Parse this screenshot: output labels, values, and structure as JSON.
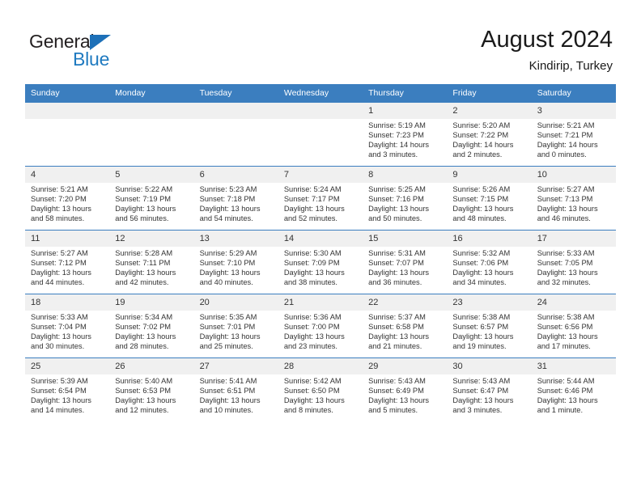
{
  "brand": {
    "name_top": "General",
    "name_bottom": "Blue",
    "triangle_color": "#1d70b8",
    "blue_text_color": "#1f7ac0"
  },
  "header": {
    "title": "August 2024",
    "subtitle": "Kindirip, Turkey",
    "header_bg_color": "#3b7ebf",
    "daynum_bg_color": "#f0f0f0"
  },
  "weekday_headers": [
    "Sunday",
    "Monday",
    "Tuesday",
    "Wednesday",
    "Thursday",
    "Friday",
    "Saturday"
  ],
  "labels": {
    "sunrise": "Sunrise:",
    "sunset": "Sunset:",
    "daylight": "Daylight:"
  },
  "weeks": [
    [
      {
        "day": "",
        "blank": true
      },
      {
        "day": "",
        "blank": true
      },
      {
        "day": "",
        "blank": true
      },
      {
        "day": "",
        "blank": true
      },
      {
        "day": "1",
        "sunrise": "Sunrise: 5:19 AM",
        "sunset": "Sunset: 7:23 PM",
        "daylight_line1": "Daylight: 14 hours",
        "daylight_line2": "and 3 minutes."
      },
      {
        "day": "2",
        "sunrise": "Sunrise: 5:20 AM",
        "sunset": "Sunset: 7:22 PM",
        "daylight_line1": "Daylight: 14 hours",
        "daylight_line2": "and 2 minutes."
      },
      {
        "day": "3",
        "sunrise": "Sunrise: 5:21 AM",
        "sunset": "Sunset: 7:21 PM",
        "daylight_line1": "Daylight: 14 hours",
        "daylight_line2": "and 0 minutes."
      }
    ],
    [
      {
        "day": "4",
        "sunrise": "Sunrise: 5:21 AM",
        "sunset": "Sunset: 7:20 PM",
        "daylight_line1": "Daylight: 13 hours",
        "daylight_line2": "and 58 minutes."
      },
      {
        "day": "5",
        "sunrise": "Sunrise: 5:22 AM",
        "sunset": "Sunset: 7:19 PM",
        "daylight_line1": "Daylight: 13 hours",
        "daylight_line2": "and 56 minutes."
      },
      {
        "day": "6",
        "sunrise": "Sunrise: 5:23 AM",
        "sunset": "Sunset: 7:18 PM",
        "daylight_line1": "Daylight: 13 hours",
        "daylight_line2": "and 54 minutes."
      },
      {
        "day": "7",
        "sunrise": "Sunrise: 5:24 AM",
        "sunset": "Sunset: 7:17 PM",
        "daylight_line1": "Daylight: 13 hours",
        "daylight_line2": "and 52 minutes."
      },
      {
        "day": "8",
        "sunrise": "Sunrise: 5:25 AM",
        "sunset": "Sunset: 7:16 PM",
        "daylight_line1": "Daylight: 13 hours",
        "daylight_line2": "and 50 minutes."
      },
      {
        "day": "9",
        "sunrise": "Sunrise: 5:26 AM",
        "sunset": "Sunset: 7:15 PM",
        "daylight_line1": "Daylight: 13 hours",
        "daylight_line2": "and 48 minutes."
      },
      {
        "day": "10",
        "sunrise": "Sunrise: 5:27 AM",
        "sunset": "Sunset: 7:13 PM",
        "daylight_line1": "Daylight: 13 hours",
        "daylight_line2": "and 46 minutes."
      }
    ],
    [
      {
        "day": "11",
        "sunrise": "Sunrise: 5:27 AM",
        "sunset": "Sunset: 7:12 PM",
        "daylight_line1": "Daylight: 13 hours",
        "daylight_line2": "and 44 minutes."
      },
      {
        "day": "12",
        "sunrise": "Sunrise: 5:28 AM",
        "sunset": "Sunset: 7:11 PM",
        "daylight_line1": "Daylight: 13 hours",
        "daylight_line2": "and 42 minutes."
      },
      {
        "day": "13",
        "sunrise": "Sunrise: 5:29 AM",
        "sunset": "Sunset: 7:10 PM",
        "daylight_line1": "Daylight: 13 hours",
        "daylight_line2": "and 40 minutes."
      },
      {
        "day": "14",
        "sunrise": "Sunrise: 5:30 AM",
        "sunset": "Sunset: 7:09 PM",
        "daylight_line1": "Daylight: 13 hours",
        "daylight_line2": "and 38 minutes."
      },
      {
        "day": "15",
        "sunrise": "Sunrise: 5:31 AM",
        "sunset": "Sunset: 7:07 PM",
        "daylight_line1": "Daylight: 13 hours",
        "daylight_line2": "and 36 minutes."
      },
      {
        "day": "16",
        "sunrise": "Sunrise: 5:32 AM",
        "sunset": "Sunset: 7:06 PM",
        "daylight_line1": "Daylight: 13 hours",
        "daylight_line2": "and 34 minutes."
      },
      {
        "day": "17",
        "sunrise": "Sunrise: 5:33 AM",
        "sunset": "Sunset: 7:05 PM",
        "daylight_line1": "Daylight: 13 hours",
        "daylight_line2": "and 32 minutes."
      }
    ],
    [
      {
        "day": "18",
        "sunrise": "Sunrise: 5:33 AM",
        "sunset": "Sunset: 7:04 PM",
        "daylight_line1": "Daylight: 13 hours",
        "daylight_line2": "and 30 minutes."
      },
      {
        "day": "19",
        "sunrise": "Sunrise: 5:34 AM",
        "sunset": "Sunset: 7:02 PM",
        "daylight_line1": "Daylight: 13 hours",
        "daylight_line2": "and 28 minutes."
      },
      {
        "day": "20",
        "sunrise": "Sunrise: 5:35 AM",
        "sunset": "Sunset: 7:01 PM",
        "daylight_line1": "Daylight: 13 hours",
        "daylight_line2": "and 25 minutes."
      },
      {
        "day": "21",
        "sunrise": "Sunrise: 5:36 AM",
        "sunset": "Sunset: 7:00 PM",
        "daylight_line1": "Daylight: 13 hours",
        "daylight_line2": "and 23 minutes."
      },
      {
        "day": "22",
        "sunrise": "Sunrise: 5:37 AM",
        "sunset": "Sunset: 6:58 PM",
        "daylight_line1": "Daylight: 13 hours",
        "daylight_line2": "and 21 minutes."
      },
      {
        "day": "23",
        "sunrise": "Sunrise: 5:38 AM",
        "sunset": "Sunset: 6:57 PM",
        "daylight_line1": "Daylight: 13 hours",
        "daylight_line2": "and 19 minutes."
      },
      {
        "day": "24",
        "sunrise": "Sunrise: 5:38 AM",
        "sunset": "Sunset: 6:56 PM",
        "daylight_line1": "Daylight: 13 hours",
        "daylight_line2": "and 17 minutes."
      }
    ],
    [
      {
        "day": "25",
        "sunrise": "Sunrise: 5:39 AM",
        "sunset": "Sunset: 6:54 PM",
        "daylight_line1": "Daylight: 13 hours",
        "daylight_line2": "and 14 minutes."
      },
      {
        "day": "26",
        "sunrise": "Sunrise: 5:40 AM",
        "sunset": "Sunset: 6:53 PM",
        "daylight_line1": "Daylight: 13 hours",
        "daylight_line2": "and 12 minutes."
      },
      {
        "day": "27",
        "sunrise": "Sunrise: 5:41 AM",
        "sunset": "Sunset: 6:51 PM",
        "daylight_line1": "Daylight: 13 hours",
        "daylight_line2": "and 10 minutes."
      },
      {
        "day": "28",
        "sunrise": "Sunrise: 5:42 AM",
        "sunset": "Sunset: 6:50 PM",
        "daylight_line1": "Daylight: 13 hours",
        "daylight_line2": "and 8 minutes."
      },
      {
        "day": "29",
        "sunrise": "Sunrise: 5:43 AM",
        "sunset": "Sunset: 6:49 PM",
        "daylight_line1": "Daylight: 13 hours",
        "daylight_line2": "and 5 minutes."
      },
      {
        "day": "30",
        "sunrise": "Sunrise: 5:43 AM",
        "sunset": "Sunset: 6:47 PM",
        "daylight_line1": "Daylight: 13 hours",
        "daylight_line2": "and 3 minutes."
      },
      {
        "day": "31",
        "sunrise": "Sunrise: 5:44 AM",
        "sunset": "Sunset: 6:46 PM",
        "daylight_line1": "Daylight: 13 hours",
        "daylight_line2": "and 1 minute."
      }
    ]
  ]
}
